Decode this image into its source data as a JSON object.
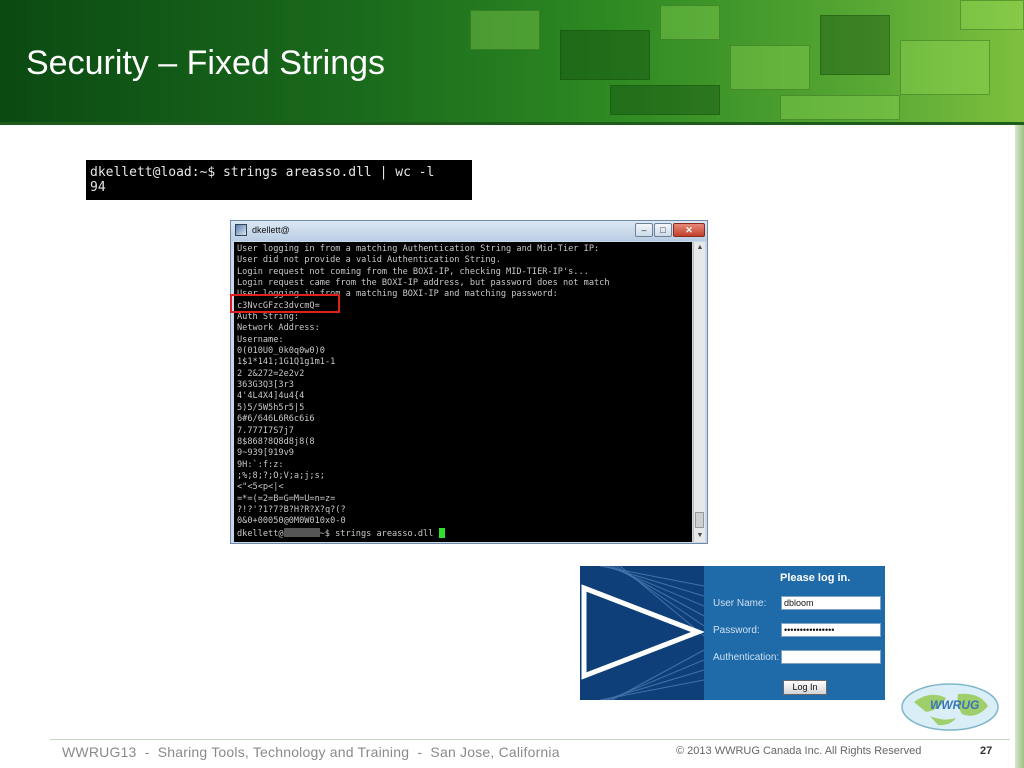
{
  "slide": {
    "title": "Security – Fixed Strings",
    "page_number": "27"
  },
  "command_strip": {
    "lines": [
      "dkellett@load:~$ strings areasso.dll | wc -l",
      "94"
    ]
  },
  "terminal": {
    "window_title": "dkellett@",
    "lines": [
      "User logging in from a matching Authentication String and Mid-Tier IP:",
      "User did not provide a valid Authentication String.",
      "Login request not coming from the BOXI-IP, checking MID-TIER-IP's...",
      "Login request came from the BOXI-IP address, but password does not match",
      "User logging in from a matching BOXI-IP and matching password:",
      "c3NvcGFzc3dvcmQ=",
      "Auth String:",
      "Network Address:",
      "Username:",
      "0(010U0_0k0q0w0)0",
      "1$1*141;1G1Q1g1m1-1",
      "2 2&272=2e2v2",
      "363G3Q3[3r3",
      "4'4L4X4]4u4{4",
      "5)5/5W5h5r5|5",
      "6#6/646L6R6c6i6",
      "7.777I7S7j7",
      "8$868?8Q8d8j8(8",
      "9~939[919v9",
      "9H:`:f:z:",
      ";%;8;?;O;V;a;j;s;",
      "<\"<5<p<|<",
      "=*=(=2=B=G=M=U=n=z=",
      "?!?'?1?7?B?H?R?X?q?(?",
      "0&0+00050@0M0W010x0-0"
    ],
    "prompt_user": "dkellett@",
    "prompt_suffix": "~$ strings areasso.dll"
  },
  "login": {
    "heading": "Please log in.",
    "username_label": "User Name:",
    "username_value": "dbloom",
    "password_label": "Password:",
    "password_value": "••••••••••••••••",
    "authentication_label": "Authentication:",
    "authentication_value": "",
    "login_button": "Log In"
  },
  "logo": {
    "text": "WWRUG",
    "icon": "globe-logo"
  },
  "footer": {
    "event": "WWRUG13  -  Sharing Tools, Technology and Training  -  San Jose, California",
    "copyright": "© 2013 WWRUG Canada Inc. All Rights Reserved"
  },
  "colors": {
    "banner_green": "#1a6a1c",
    "login_blue": "#1f6aa8",
    "highlight_red": "#e0201c",
    "cursor_green": "#2ee02e"
  }
}
